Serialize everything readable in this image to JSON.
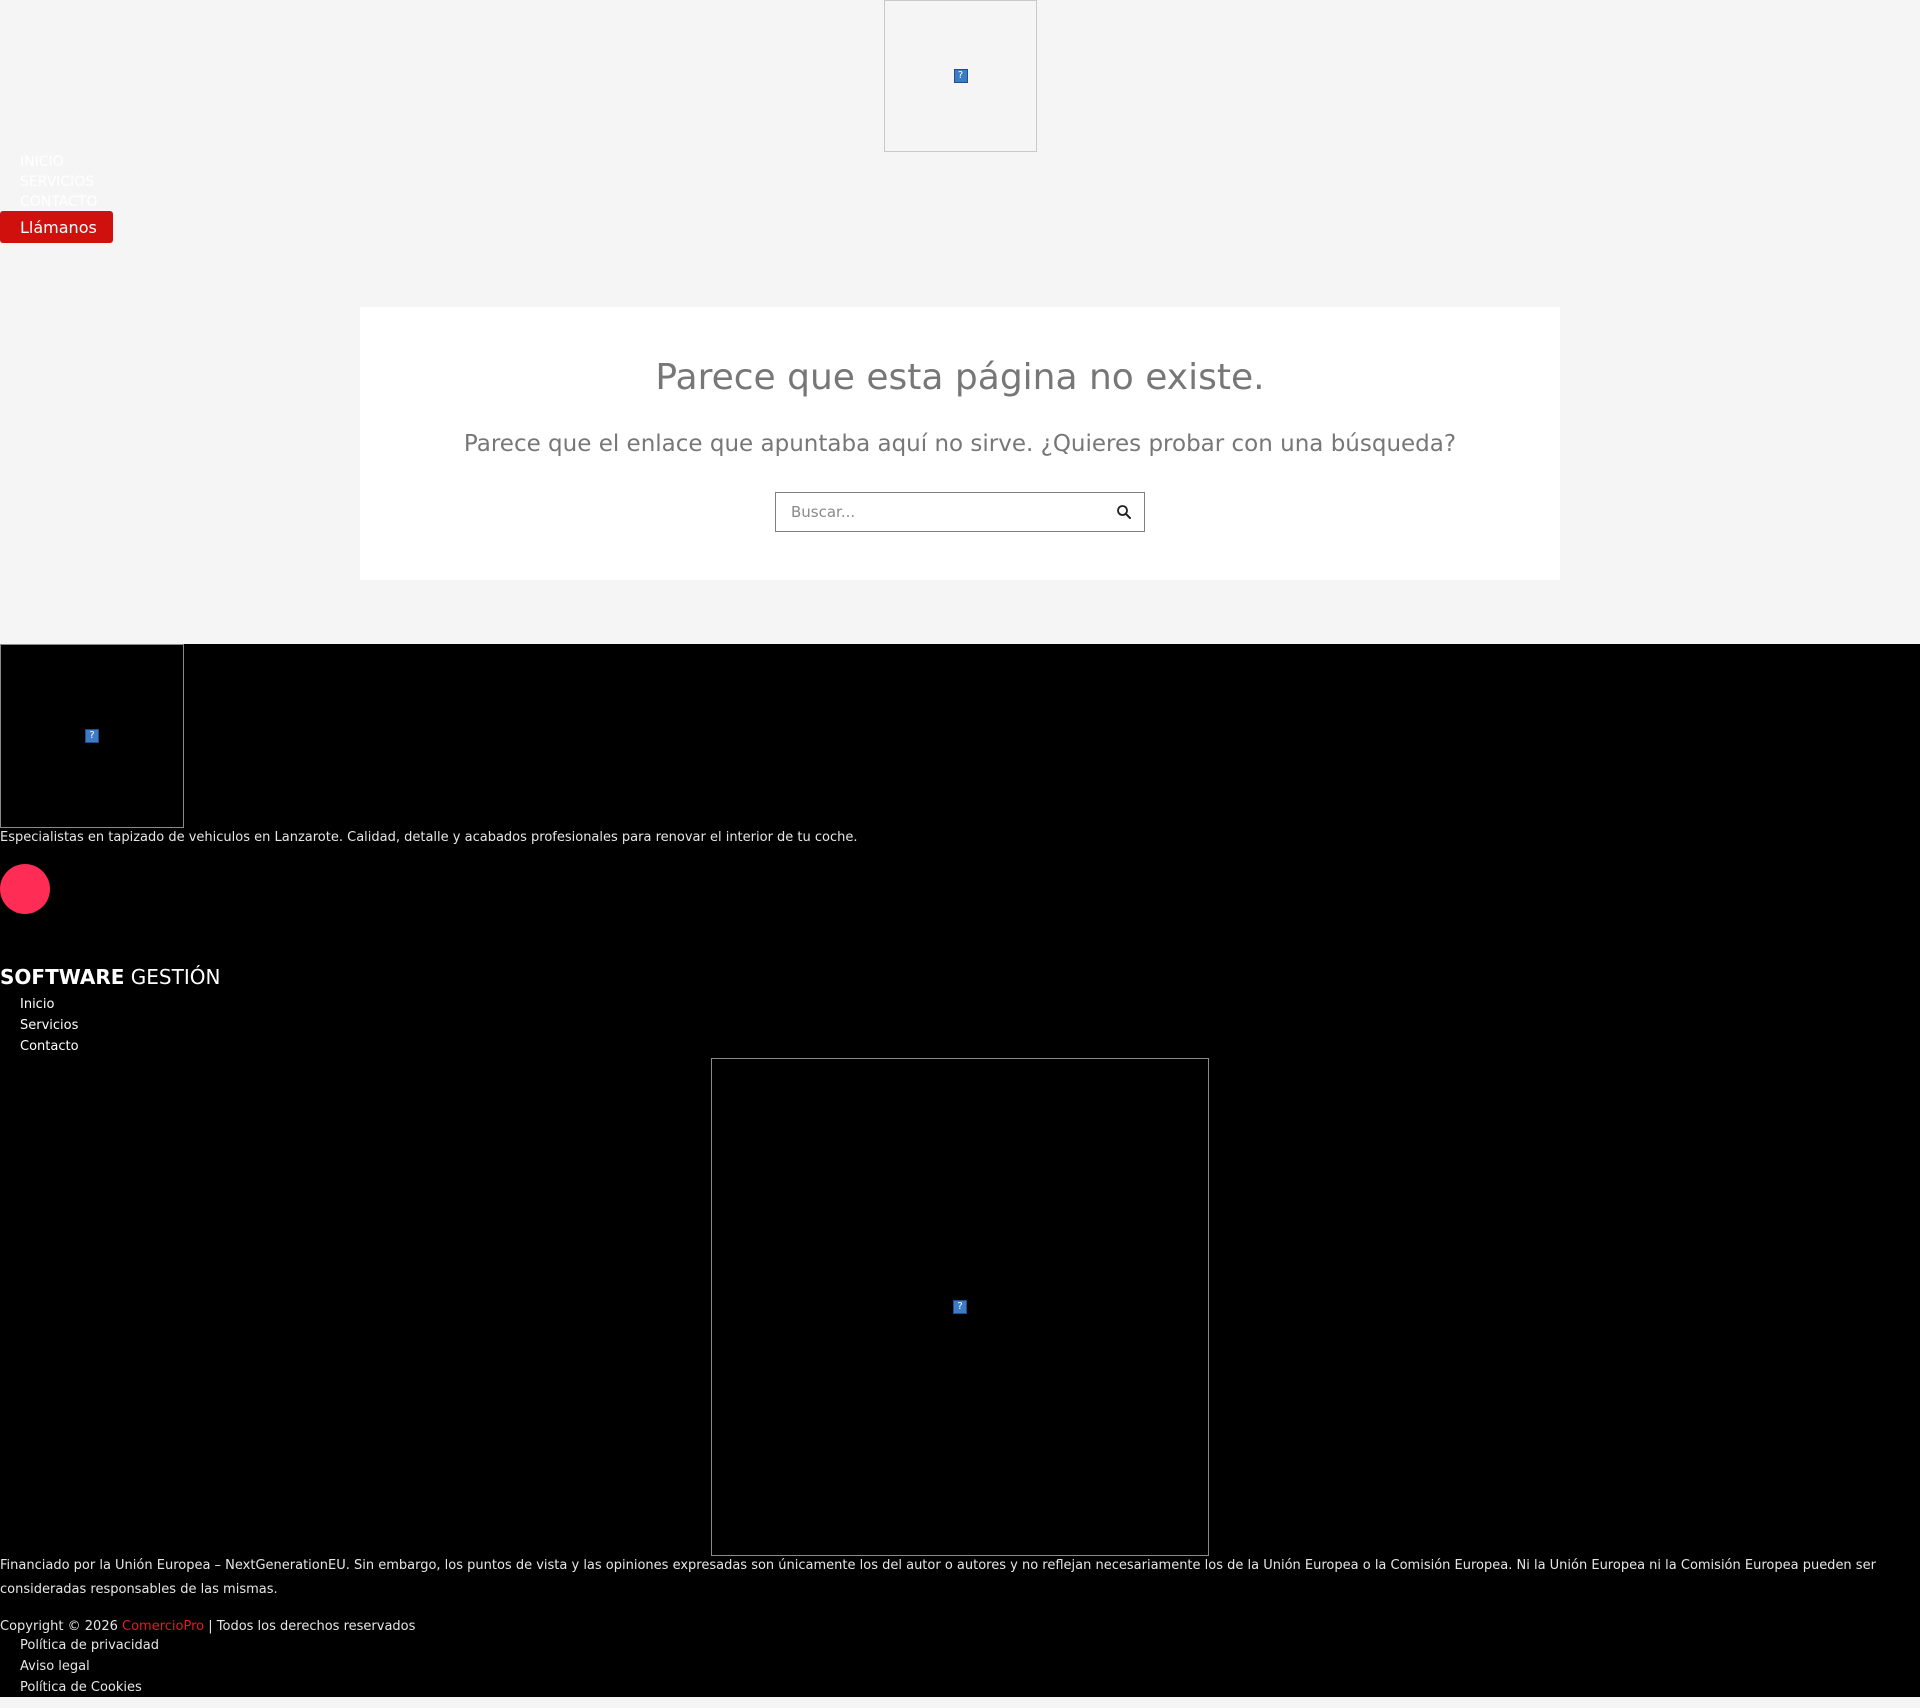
{
  "header": {
    "logo_icon": "broken-image-icon",
    "broken_glyph": "?",
    "nav": [
      "INICIO",
      "SERVICIOS",
      "CONTACTO"
    ],
    "call_button": "Llámanos"
  },
  "not_found": {
    "title": "Parece que esta página no existe.",
    "message": "Parece que el enlace que apuntaba aquí no sirve. ¿Quieres probar con una búsqueda?",
    "search_placeholder": "Buscar...",
    "search_icon": "search-icon"
  },
  "footer": {
    "tagline": "Especialistas en tapizado de vehiculos en Lanzarote. Calidad, detalle y acabados profesionales para renovar el interior de tu coche.",
    "heading_strong": "SOFTWARE",
    "heading_rest": " GESTIÓN",
    "nav": [
      "Inicio",
      "Servicios",
      "Contacto"
    ],
    "eu_notice": "Financiado por la Unión Europea – NextGenerationEU. Sin embargo, los puntos de vista y las opiniones expresadas son únicamente los del autor o autores y no reflejan necesariamente los de la Unión Europea o la Comisión Europea. Ni la Unión Europea ni la Comisión Europea pueden ser consideradas responsables de las mismas.",
    "copyright_prefix": "Copyright © 2026 ",
    "brand": "ComercioPro",
    "copyright_suffix": " | Todos los derechos reservados",
    "legal": [
      "Política de privacidad",
      "Aviso legal",
      "Política de Cookies"
    ]
  },
  "colors": {
    "page_bg": "#f5f5f5",
    "footer_bg": "#000000",
    "accent_red": "#d0100c",
    "social_pink": "#ff2d55"
  }
}
